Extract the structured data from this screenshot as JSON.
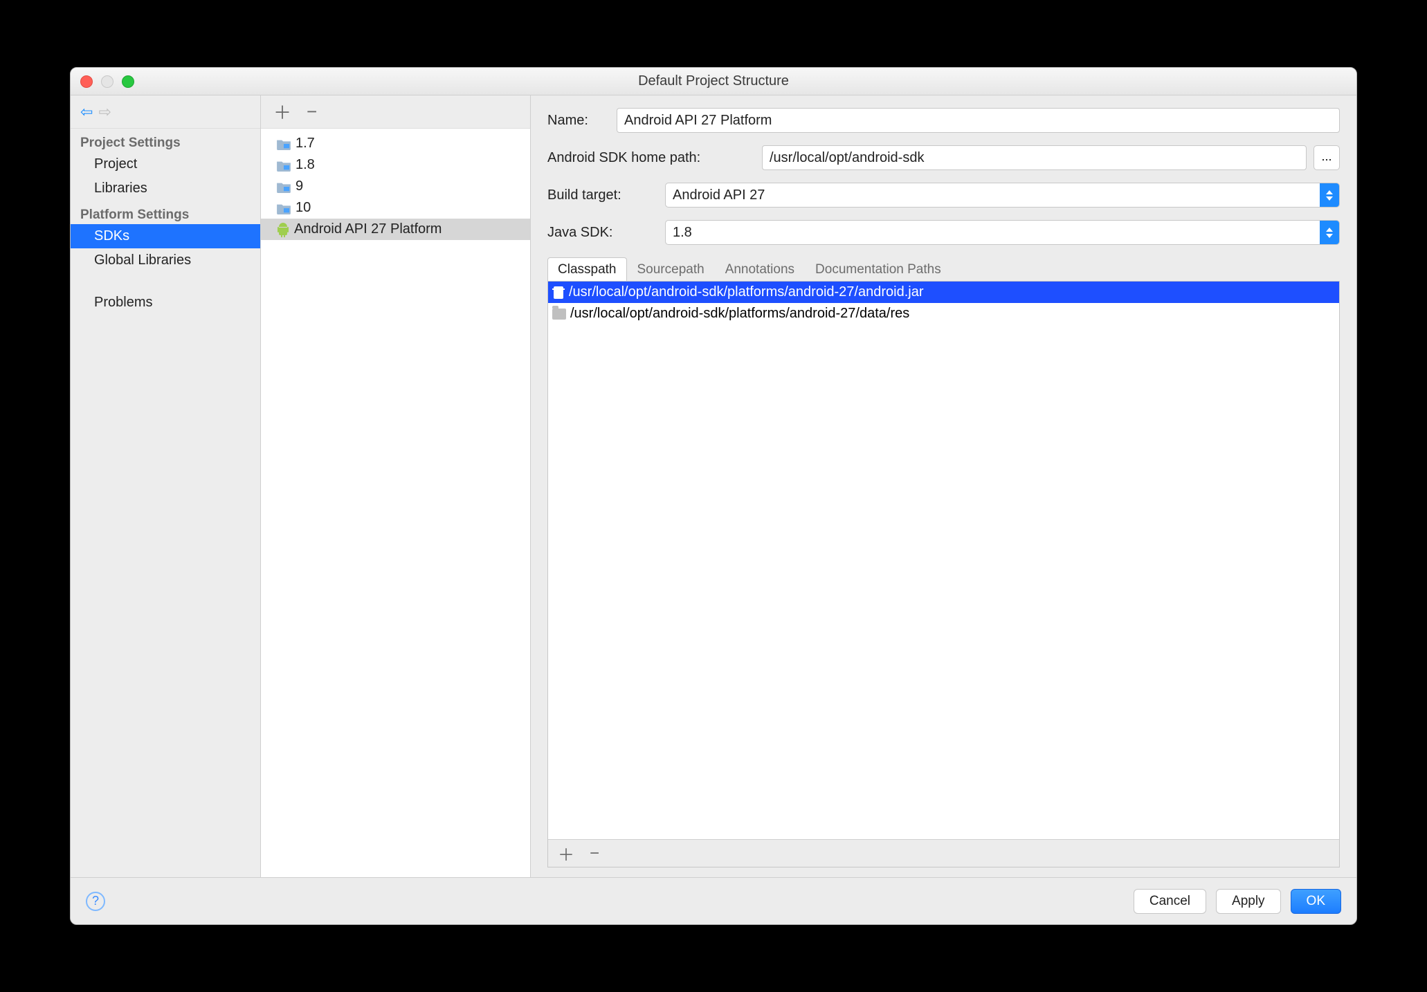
{
  "window": {
    "title": "Default Project Structure"
  },
  "leftnav": {
    "sections": [
      {
        "heading": "Project Settings",
        "items": [
          "Project",
          "Libraries"
        ]
      },
      {
        "heading": "Platform Settings",
        "items": [
          "SDKs",
          "Global Libraries"
        ]
      }
    ],
    "selected": "SDKs",
    "problems": "Problems"
  },
  "sdklist": {
    "items": [
      {
        "label": "1.7",
        "type": "jdk"
      },
      {
        "label": "1.8",
        "type": "jdk"
      },
      {
        "label": "9",
        "type": "jdk"
      },
      {
        "label": "10",
        "type": "jdk"
      },
      {
        "label": "Android API 27 Platform",
        "type": "android"
      }
    ],
    "selected": "Android API 27 Platform"
  },
  "form": {
    "name_label": "Name:",
    "name_value": "Android API 27 Platform",
    "sdk_home_label": "Android SDK home path:",
    "sdk_home_value": "/usr/local/opt/android-sdk",
    "browse": "...",
    "build_target_label": "Build target:",
    "build_target_value": "Android API 27",
    "java_sdk_label": "Java SDK:",
    "java_sdk_value": "1.8"
  },
  "tabs": {
    "items": [
      "Classpath",
      "Sourcepath",
      "Annotations",
      "Documentation Paths"
    ],
    "active": "Classpath"
  },
  "classpath": {
    "entries": [
      {
        "path": "/usr/local/opt/android-sdk/platforms/android-27/android.jar",
        "kind": "jar",
        "selected": true
      },
      {
        "path": "/usr/local/opt/android-sdk/platforms/android-27/data/res",
        "kind": "dir",
        "selected": false
      }
    ]
  },
  "buttons": {
    "cancel": "Cancel",
    "apply": "Apply",
    "ok": "OK"
  }
}
